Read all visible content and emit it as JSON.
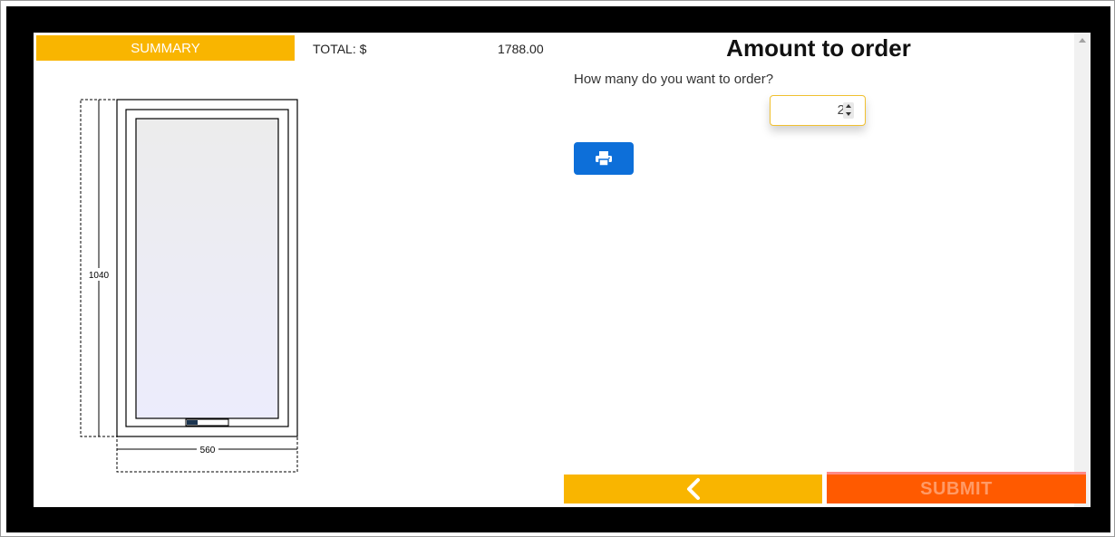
{
  "summary": {
    "label": "SUMMARY"
  },
  "total": {
    "label": "TOTAL: $",
    "value": "1788.00"
  },
  "drawing": {
    "height_label": "1040",
    "width_label": "560"
  },
  "order": {
    "title": "Amount to order",
    "question": "How many do you want to order?",
    "quantity": "2"
  },
  "icons": {
    "print": "print-icon",
    "back": "chevron-left-icon"
  },
  "buttons": {
    "submit_label": "SUBMIT"
  },
  "colors": {
    "accent": "#f9b500",
    "primary": "#0d6fd9",
    "submit": "#ff5a00"
  }
}
